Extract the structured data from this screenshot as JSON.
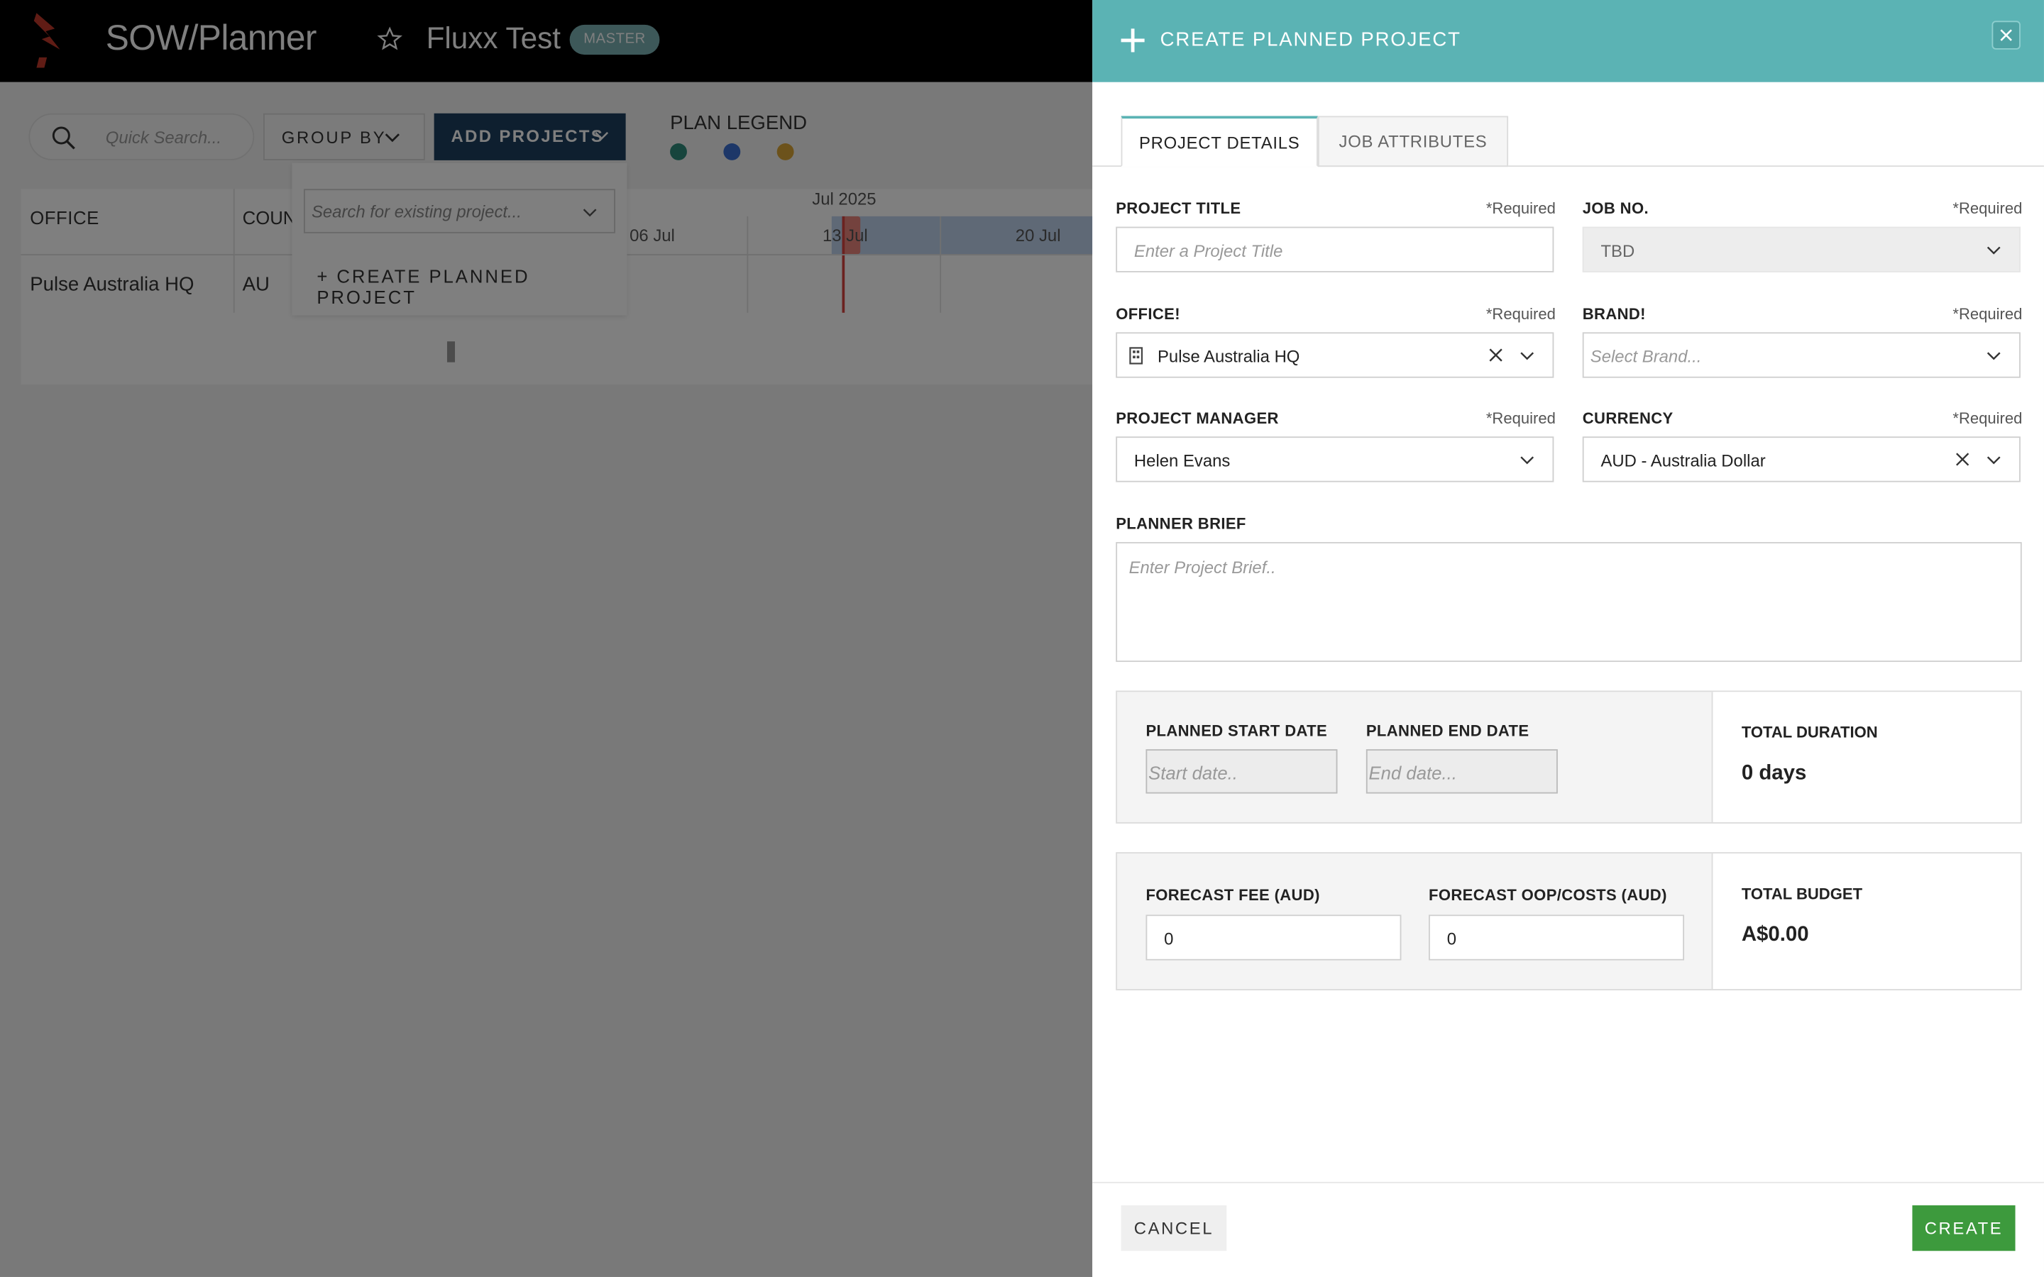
{
  "app": {
    "title": "SOW/Planner",
    "workspace": "Fluxx Test",
    "badge": "MASTER"
  },
  "toolbar": {
    "search_placeholder": "Quick Search...",
    "group_by_label": "GROUP BY",
    "add_projects_label": "ADD PROJECTS",
    "legend_title": "PLAN LEGEND",
    "legend_colors": [
      "#2e8b7a",
      "#3a6fd0",
      "#d9a437"
    ]
  },
  "table": {
    "columns": [
      "OFFICE",
      "COUN"
    ],
    "rows": [
      {
        "office": "Pulse Australia HQ",
        "country": "AU"
      }
    ],
    "timeline": {
      "month": "Jul 2025",
      "weeks": [
        "06 Jul",
        "13 Jul",
        "20 Jul"
      ]
    }
  },
  "add_menu": {
    "search_placeholder": "Search for existing project...",
    "create_label": "+ CREATE PLANNED PROJECT"
  },
  "drawer": {
    "title": "CREATE PLANNED PROJECT",
    "tabs": [
      "PROJECT DETAILS",
      "JOB ATTRIBUTES"
    ],
    "required_text": "*Required",
    "fields": {
      "project_title": {
        "label": "PROJECT TITLE",
        "placeholder": "Enter a Project Title"
      },
      "job_no": {
        "label": "JOB NO.",
        "value": "TBD"
      },
      "office": {
        "label": "OFFICE!",
        "value": "Pulse Australia HQ"
      },
      "brand": {
        "label": "BRAND!",
        "placeholder": "Select Brand..."
      },
      "project_manager": {
        "label": "PROJECT MANAGER",
        "value": "Helen Evans"
      },
      "currency": {
        "label": "CURRENCY",
        "value": "AUD - Australia Dollar"
      },
      "planner_brief": {
        "label": "PLANNER BRIEF",
        "placeholder": "Enter Project Brief.."
      }
    },
    "dates": {
      "start_label": "PLANNED START DATE",
      "start_placeholder": "Start date..",
      "end_label": "PLANNED END DATE",
      "end_placeholder": "End date...",
      "total_label": "TOTAL DURATION",
      "total_value": "0 days"
    },
    "budget": {
      "fee_label": "FORECAST FEE (AUD)",
      "fee_value": "0",
      "oop_label": "FORECAST OOP/COSTS (AUD)",
      "oop_value": "0",
      "total_label": "TOTAL BUDGET",
      "total_value": "A$0.00"
    },
    "cancel_label": "CANCEL",
    "create_label": "CREATE"
  }
}
